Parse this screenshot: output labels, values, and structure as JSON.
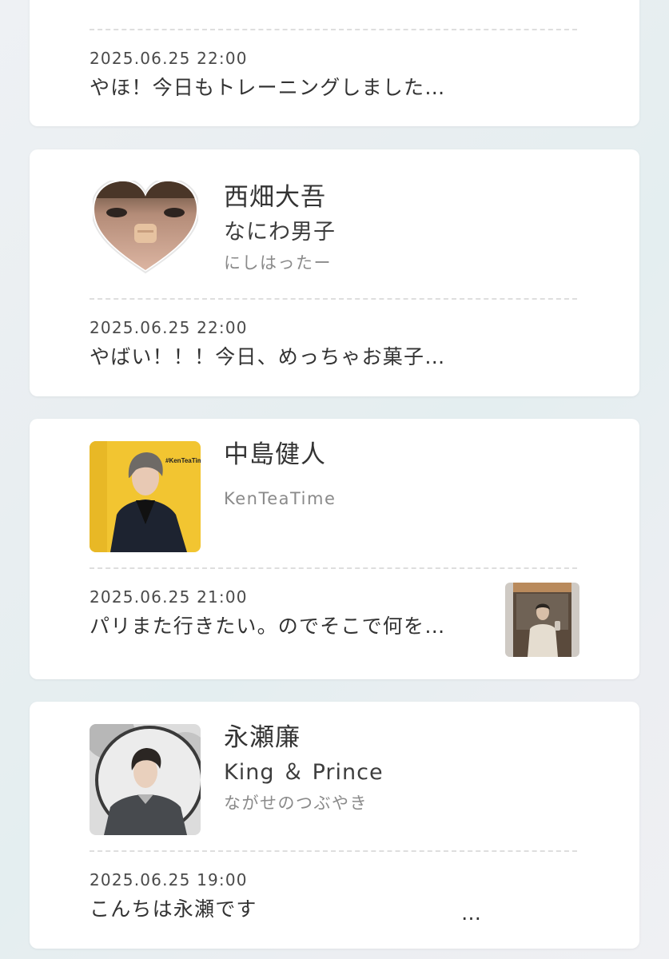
{
  "posts": [
    {
      "date": "2025.06.25 22:00",
      "preview": "やほ！今日もトレーニングしました…"
    },
    {
      "name": "西畑大吾",
      "group": "なにわ男子",
      "handle": "にしはったー",
      "date": "2025.06.25 22:00",
      "preview": "やばい！！！今日、めっちゃお菓子…"
    },
    {
      "name": "中島健人",
      "handle": "KenTeaTime",
      "avatar_caption": "#KenTeaTime",
      "date": "2025.06.25 21:00",
      "preview": "パリまた行きたい。のでそこで何を…"
    },
    {
      "name": "永瀬廉",
      "group": "King ＆ Prince",
      "handle": "ながせのつぶやき",
      "date": "2025.06.25 19:00",
      "preview": "こんちは永瀬です",
      "ellipsis": "…"
    }
  ],
  "colors": {
    "card_bg": "#ffffff",
    "divider": "#dedede",
    "name_text": "#333333",
    "handle_text": "#8a8a8a",
    "ken_avatar_bg": "#f2c531"
  }
}
